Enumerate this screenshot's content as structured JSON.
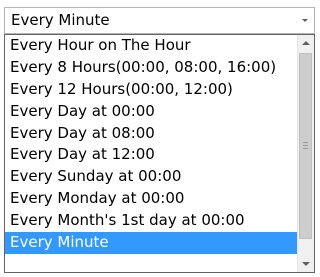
{
  "combo": {
    "selected_value": "Every Minute",
    "arrow_icon": "chevron-down-icon"
  },
  "dropdown": {
    "options": [
      "Every Hour on The Hour",
      "Every 8 Hours(00:00, 08:00, 16:00)",
      "Every 12 Hours(00:00, 12:00)",
      "Every Day at 00:00",
      "Every Day at 08:00",
      "Every Day at 12:00",
      "Every Sunday at 00:00",
      "Every Monday at 00:00",
      "Every Month's 1st day at 00:00",
      "Every Minute"
    ],
    "selected_index": 9
  },
  "colors": {
    "selection": "#3399ff",
    "selection_text": "#ffffff",
    "border": "#646464"
  }
}
